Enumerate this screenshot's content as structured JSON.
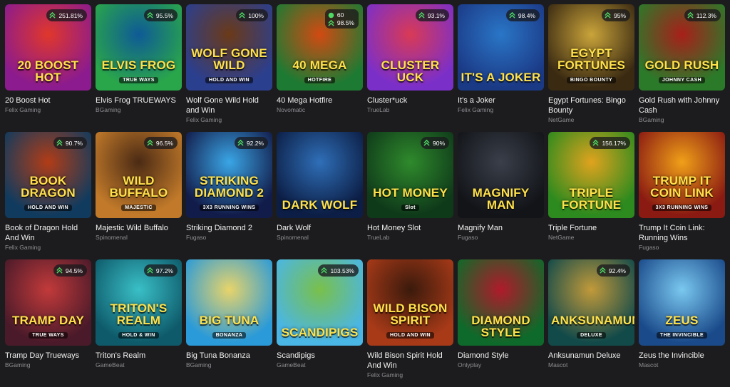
{
  "games": [
    {
      "title": "20 Boost Hot",
      "provider": "Felix Gaming",
      "rtp": "251.81%",
      "logo": "20 BOOST HOT",
      "sub": "",
      "colors": [
        "#8b1b8e",
        "#e0372b"
      ]
    },
    {
      "title": "Elvis Frog TRUEWAYS",
      "provider": "BGaming",
      "rtp": "95.5%",
      "logo": "ELVIS FROG",
      "sub": "TRUE WAYS",
      "colors": [
        "#2aa64a",
        "#0e5a96"
      ]
    },
    {
      "title": "Wolf Gone Wild Hold and Win",
      "provider": "Felix Gaming",
      "rtp": "100%",
      "logo": "WOLF GONE WILD",
      "sub": "HOLD AND WIN",
      "colors": [
        "#2b3f8f",
        "#6b3a18"
      ]
    },
    {
      "title": "40 Mega Hotfire",
      "provider": "Novomatic",
      "rtp": "98.5%",
      "rtp2": "60",
      "logo": "40 MEGA",
      "sub": "HOTFIRE",
      "colors": [
        "#1d7a33",
        "#d24a12"
      ]
    },
    {
      "title": "Cluster*uck",
      "provider": "TrueLab",
      "rtp": "93.1%",
      "logo": "CLUSTER UCK",
      "sub": "",
      "colors": [
        "#7b2fc9",
        "#d93a55"
      ]
    },
    {
      "title": "It's a Joker",
      "provider": "Felix Gaming",
      "rtp": "98.4%",
      "logo": "IT'S A JOKER",
      "sub": "",
      "colors": [
        "#1b3a86",
        "#2a76c7"
      ]
    },
    {
      "title": "Egypt Fortunes: Bingo Bounty",
      "provider": "NetGame",
      "rtp": "95%",
      "logo": "EGYPT FORTUNES",
      "sub": "BINGO BOUNTY",
      "colors": [
        "#3a2a12",
        "#caa43a"
      ]
    },
    {
      "title": "Gold Rush with Johnny Cash",
      "provider": "BGaming",
      "rtp": "112.3%",
      "logo": "GOLD RUSH",
      "sub": "JOHNNY CASH",
      "colors": [
        "#2b7a2a",
        "#a81f1a"
      ]
    },
    {
      "title": "Book of Dragon Hold And Win",
      "provider": "Felix Gaming",
      "rtp": "90.7%",
      "logo": "BOOK DRAGON",
      "sub": "HOLD AND WIN",
      "colors": [
        "#113b5e",
        "#b23c16"
      ]
    },
    {
      "title": "Majestic Wild Buffalo",
      "provider": "Spinomenal",
      "rtp": "96.5%",
      "logo": "WILD BUFFALO",
      "sub": "MAJESTIC",
      "colors": [
        "#c27a2a",
        "#4a2a14"
      ]
    },
    {
      "title": "Striking Diamond 2",
      "provider": "Fugaso",
      "rtp": "92.2%",
      "logo": "STRIKING DIAMOND 2",
      "sub": "3X3 RUNNING WINS",
      "colors": [
        "#121c4a",
        "#3aa6e6"
      ]
    },
    {
      "title": "Dark Wolf",
      "provider": "Spinomenal",
      "rtp": "",
      "logo": "DARK WOLF",
      "sub": "",
      "colors": [
        "#0c1e45",
        "#2f6fb8"
      ]
    },
    {
      "title": "Hot Money Slot",
      "provider": "TrueLab",
      "rtp": "90%",
      "logo": "HOT MONEY",
      "sub": "Slot",
      "colors": [
        "#0f3a1a",
        "#2f8a2c"
      ]
    },
    {
      "title": "Magnify Man",
      "provider": "Fugaso",
      "rtp": "",
      "logo": "MAGNIFY MAN",
      "sub": "",
      "colors": [
        "#121418",
        "#3a3f4a"
      ]
    },
    {
      "title": "Triple Fortune",
      "provider": "NetGame",
      "rtp": "156.17%",
      "logo": "TRIPLE FORTUNE",
      "sub": "",
      "colors": [
        "#2c8a1e",
        "#e0a31e"
      ]
    },
    {
      "title": "Trump It Coin Link: Running Wins",
      "provider": "Fugaso",
      "rtp": "",
      "logo": "TRUMP IT COIN LINK",
      "sub": "3X3 RUNNING WINS",
      "colors": [
        "#8a1a12",
        "#f0a018"
      ]
    },
    {
      "title": "Tramp Day Trueways",
      "provider": "BGaming",
      "rtp": "94.5%",
      "logo": "TRAMP DAY",
      "sub": "TRUE WAYS",
      "colors": [
        "#4a1a2a",
        "#c23a3a"
      ]
    },
    {
      "title": "Triton's Realm",
      "provider": "GameBeat",
      "rtp": "97.2%",
      "logo": "TRITON'S REALM",
      "sub": "HOLD & WIN",
      "colors": [
        "#0e5a6a",
        "#3ac0c7"
      ]
    },
    {
      "title": "Big Tuna Bonanza",
      "provider": "BGaming",
      "rtp": "",
      "logo": "BIG TUNA",
      "sub": "BONANZA",
      "colors": [
        "#2a9ad8",
        "#e8d46a"
      ]
    },
    {
      "title": "Scandipigs",
      "provider": "GameBeat",
      "rtp": "103.53%",
      "logo": "SCANDIPIGS",
      "sub": "",
      "colors": [
        "#4ab6e6",
        "#7ac04a"
      ]
    },
    {
      "title": "Wild Bison Spirit Hold And Win",
      "provider": "Felix Gaming",
      "rtp": "",
      "logo": "WILD BISON SPIRIT",
      "sub": "HOLD AND WIN",
      "colors": [
        "#a83a18",
        "#3a1a0c"
      ]
    },
    {
      "title": "Diamond Style",
      "provider": "Onlyplay",
      "rtp": "",
      "logo": "DIAMOND STYLE",
      "sub": "",
      "colors": [
        "#0e6a2a",
        "#b01a2a"
      ]
    },
    {
      "title": "Anksunamun Deluxe",
      "provider": "Mascot",
      "rtp": "92.4%",
      "logo": "ANKSUNAMUN",
      "sub": "DELUXE",
      "colors": [
        "#124a4a",
        "#c29a3a"
      ]
    },
    {
      "title": "Zeus the Invincible",
      "provider": "Mascot",
      "rtp": "",
      "logo": "ZEUS",
      "sub": "THE INVINCIBLE",
      "colors": [
        "#1a4a8a",
        "#7ac8f0"
      ]
    }
  ]
}
